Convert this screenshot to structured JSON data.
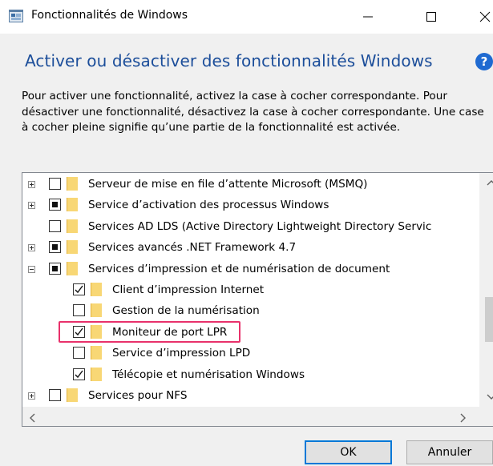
{
  "window": {
    "title": "Fonctionnalités de Windows",
    "minimize_glyph": "—",
    "close_glyph": "✕"
  },
  "header": {
    "heading": "Activer ou désactiver des fonctionnalités Windows",
    "help_glyph": "?",
    "description": "Pour activer une fonctionnalité, activez la case à cocher correspondante. Pour désactiver une fonctionnalité, désactivez la case à cocher correspondante. Une case à cocher pleine signifie qu’une partie de la fonctionnalité est activée."
  },
  "features": [
    {
      "label": "Serveur de mise en file d’attente Microsoft (MSMQ)",
      "state": "unchecked",
      "expander": "plus",
      "level": 0
    },
    {
      "label": "Service d’activation des processus Windows",
      "state": "partial",
      "expander": "plus",
      "level": 0
    },
    {
      "label": "Services AD LDS (Active Directory Lightweight Directory Servic",
      "state": "unchecked",
      "expander": "none",
      "level": 0
    },
    {
      "label": "Services avancés .NET Framework 4.7",
      "state": "partial",
      "expander": "plus",
      "level": 0
    },
    {
      "label": "Services d’impression et de numérisation de document",
      "state": "partial",
      "expander": "minus",
      "level": 0
    },
    {
      "label": "Client d’impression Internet",
      "state": "checked",
      "expander": "none",
      "level": 1
    },
    {
      "label": "Gestion de la numérisation",
      "state": "unchecked",
      "expander": "none",
      "level": 1
    },
    {
      "label": "Moniteur de port LPR",
      "state": "checked",
      "expander": "none",
      "level": 1,
      "highlighted": true
    },
    {
      "label": "Service d’impression LPD",
      "state": "unchecked",
      "expander": "none",
      "level": 1
    },
    {
      "label": "Télécopie et numérisation Windows",
      "state": "checked",
      "expander": "none",
      "level": 1
    },
    {
      "label": "Services pour NFS",
      "state": "unchecked",
      "expander": "plus",
      "level": 0
    }
  ],
  "buttons": {
    "ok": "OK",
    "cancel": "Annuler"
  },
  "colors": {
    "heading": "#1c4e9a",
    "highlight": "#e8316b",
    "folder": "#f8d775",
    "ok_border": "#0078d7"
  }
}
